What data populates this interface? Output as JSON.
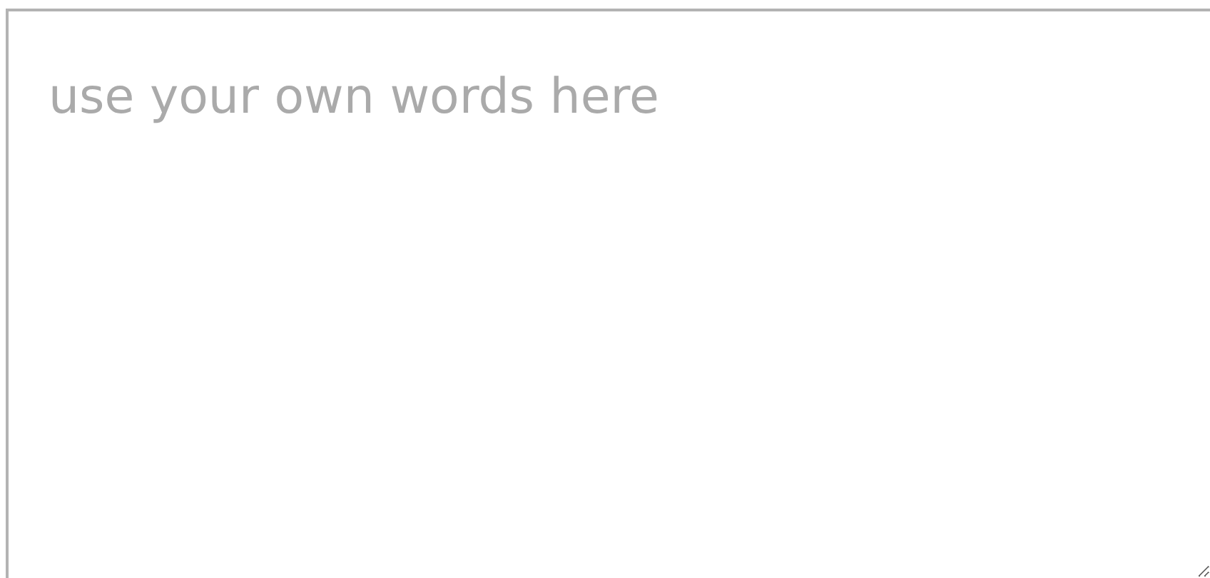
{
  "text_area": {
    "placeholder": "use your own words here"
  }
}
